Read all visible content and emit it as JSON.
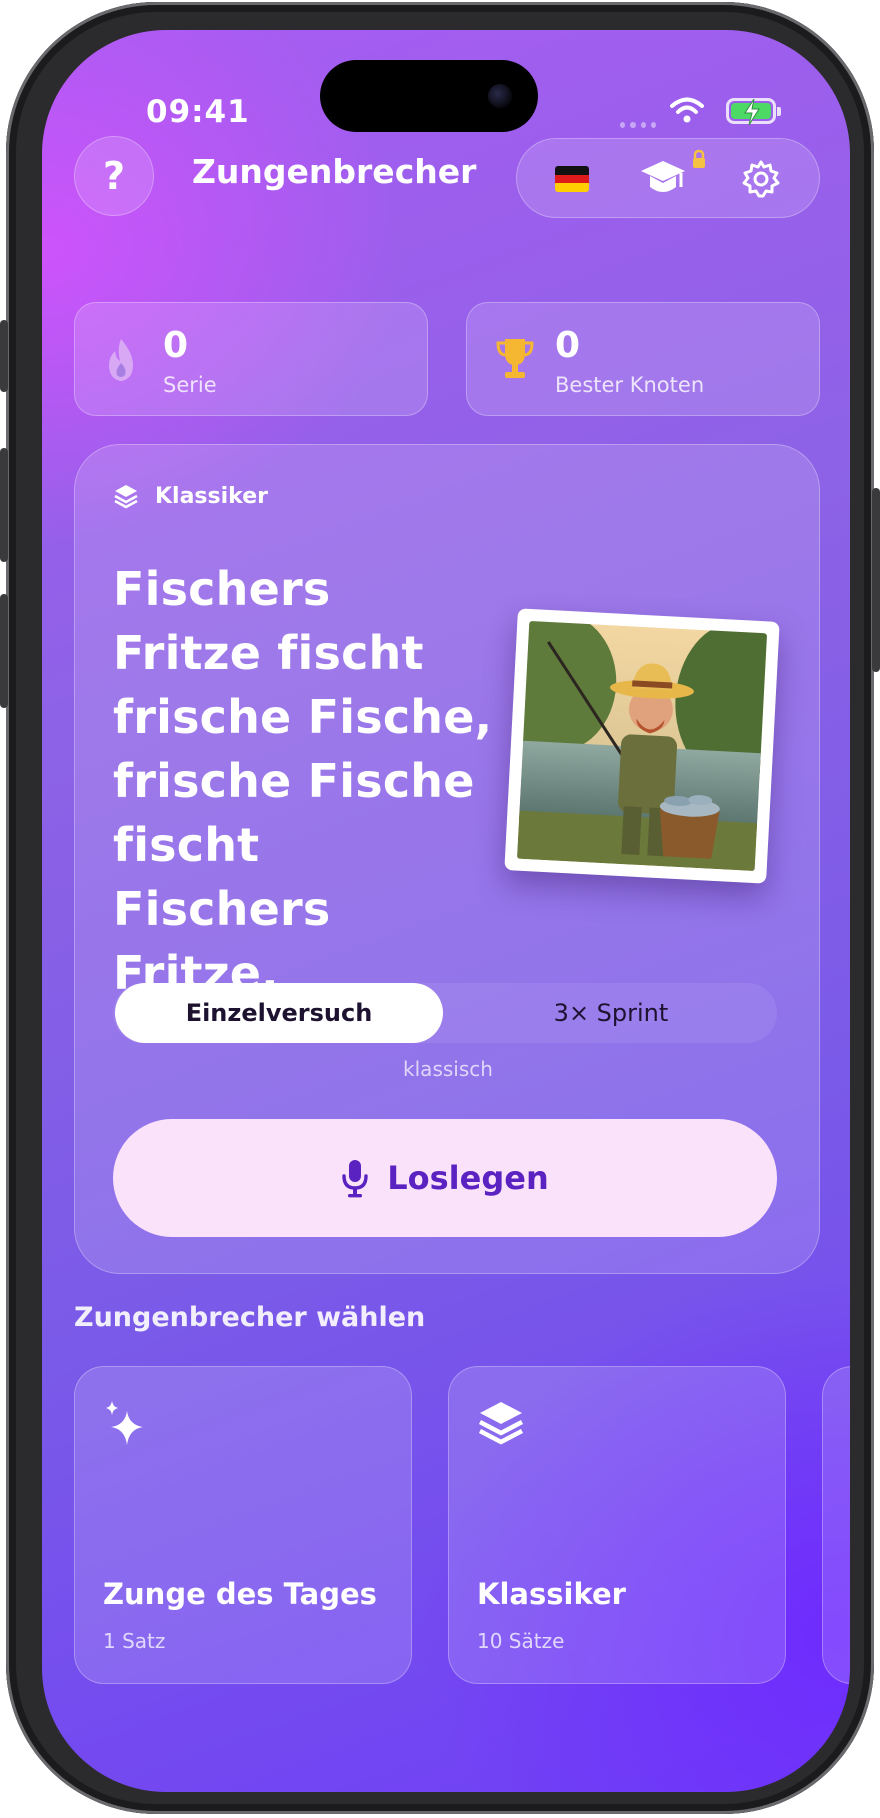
{
  "status_bar": {
    "time": "09:41"
  },
  "header": {
    "help_label": "?",
    "title": "Zungenbrecher",
    "actions": {
      "flag": "german-flag-icon",
      "learn": "graduation-cap-icon",
      "learn_locked": true,
      "settings": "gear-icon"
    }
  },
  "stats": [
    {
      "value": "0",
      "label": "Serie",
      "icon": "flame-icon"
    },
    {
      "value": "0",
      "label": "Bester Knoten",
      "icon": "trophy-icon"
    }
  ],
  "current": {
    "collection": "Klassiker",
    "text": "Fischers Fritze fischt frische Fische, frische Fische fischt Fischers Fritze.",
    "image": "fisherman-illustration"
  },
  "modes": {
    "options": [
      "Einzelversuch",
      "3× Sprint"
    ],
    "selected": "Einzelversuch",
    "hint": "klassisch"
  },
  "start_button": {
    "label": "Loslegen",
    "icon": "microphone-icon"
  },
  "picker": {
    "title": "Zungenbrecher wählen",
    "items": [
      {
        "name": "Zunge des Tages",
        "count": "1 Satz",
        "icon": "sparkles-icon"
      },
      {
        "name": "Klassiker",
        "count": "10 Sätze",
        "icon": "stack-icon"
      }
    ]
  },
  "colors": {
    "accent": "#5a22c0",
    "button_bg": "#fbe2fb",
    "trophy": "#f5b731",
    "flame": "#d9a8f5",
    "lock": "#f5c242"
  }
}
